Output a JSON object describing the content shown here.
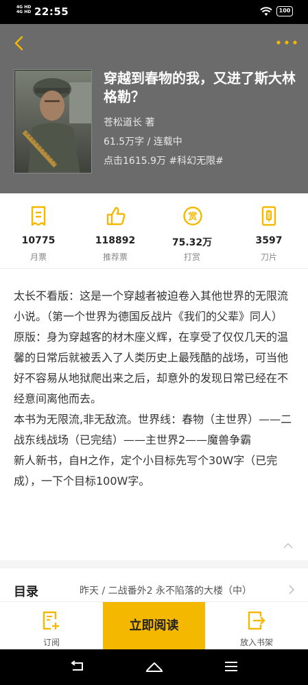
{
  "status_bar": {
    "network": "4G HD 4G HD",
    "time": "22:55",
    "battery": "100"
  },
  "book": {
    "title": "穿越到春物的我，又进了斯大林格勒？",
    "author": "苍松道长  著",
    "words_status": "61.5万字 / 连载中",
    "clicks_tag": "点击1615.9万  #科幻无限#"
  },
  "stats": [
    {
      "value": "10775",
      "label": "月票",
      "icon": "monthly-ticket-icon"
    },
    {
      "value": "118892",
      "label": "推荐票",
      "icon": "thumbs-up-icon"
    },
    {
      "value": "75.32万",
      "label": "打赏",
      "icon": "reward-coin-icon"
    },
    {
      "value": "3597",
      "label": "刀片",
      "icon": "blade-icon"
    }
  ],
  "description": "太长不看版：这是一个穿越者被迫卷入其他世界的无限流小说。（第一个世界为德国反战片《我们的父辈》同人）\n原版：身为穿越客的材木座义辉，在享受了仅仅几天的温馨的日常后就被丢入了人类历史上最残酷的战场，可当他好不容易从地狱爬出来之后，却意外的发现日常已经在不经意间离他而去。\n本书为无限流,非无敌流。世界线：春物（主世界）——二战东线战场（已完结）——主世界2——魔兽争霸\n新人新书，自H之作，定个小目标先写个30W字（已完成），一下个目标100W字。",
  "catalog": {
    "label": "目录",
    "latest": "昨天 / 二战番外2 永不陷落的大楼（中）"
  },
  "bottom": {
    "subscribe": "订阅",
    "read_now": "立即阅读",
    "add_shelf": "放入书架"
  },
  "colors": {
    "accent": "#f5b800",
    "header_bg": "#6b6b6b",
    "icon_yellow": "#f5b800"
  }
}
